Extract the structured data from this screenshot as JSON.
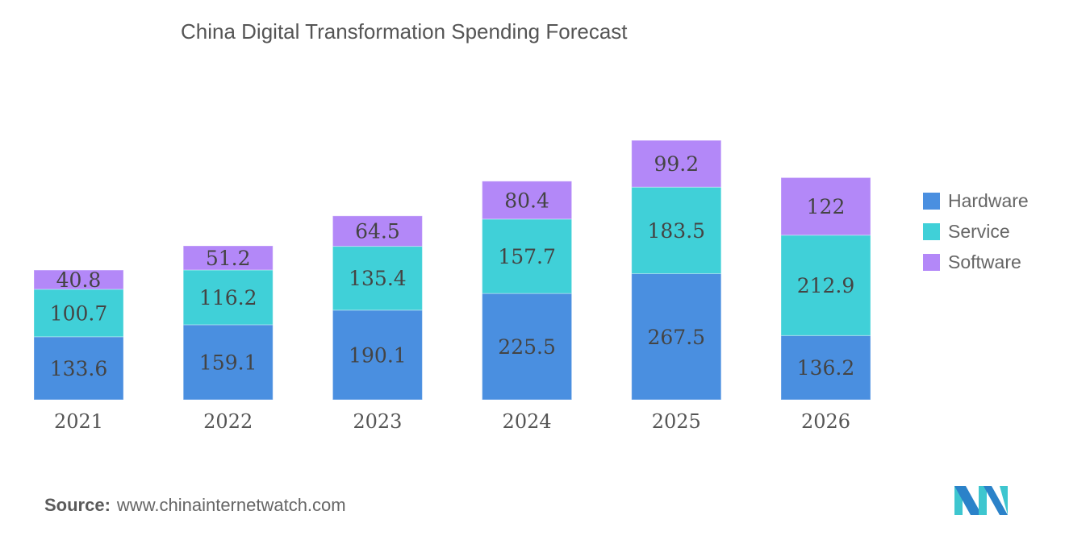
{
  "chart_data": {
    "type": "bar",
    "stacked": true,
    "title": "China Digital Transformation Spending Forecast",
    "xlabel": "",
    "ylabel": "",
    "categories": [
      "2021",
      "2022",
      "2023",
      "2024",
      "2025",
      "2026"
    ],
    "series": [
      {
        "name": "Hardware",
        "color": "#4a8fe0",
        "values": [
          133.6,
          159.1,
          190.1,
          225.5,
          267.5,
          136.2
        ]
      },
      {
        "name": "Service",
        "color": "#40d0d8",
        "values": [
          100.7,
          116.2,
          135.4,
          157.7,
          183.5,
          212.9
        ]
      },
      {
        "name": "Software",
        "color": "#b388f8",
        "values": [
          40.8,
          51.2,
          64.5,
          80.4,
          99.2,
          122
        ]
      }
    ],
    "legend_position": "right",
    "grid": false
  },
  "source": {
    "label": "Source:",
    "text": "www.chinainternetwatch.com"
  },
  "logo": {
    "name": "mordor-intelligence-logo"
  }
}
